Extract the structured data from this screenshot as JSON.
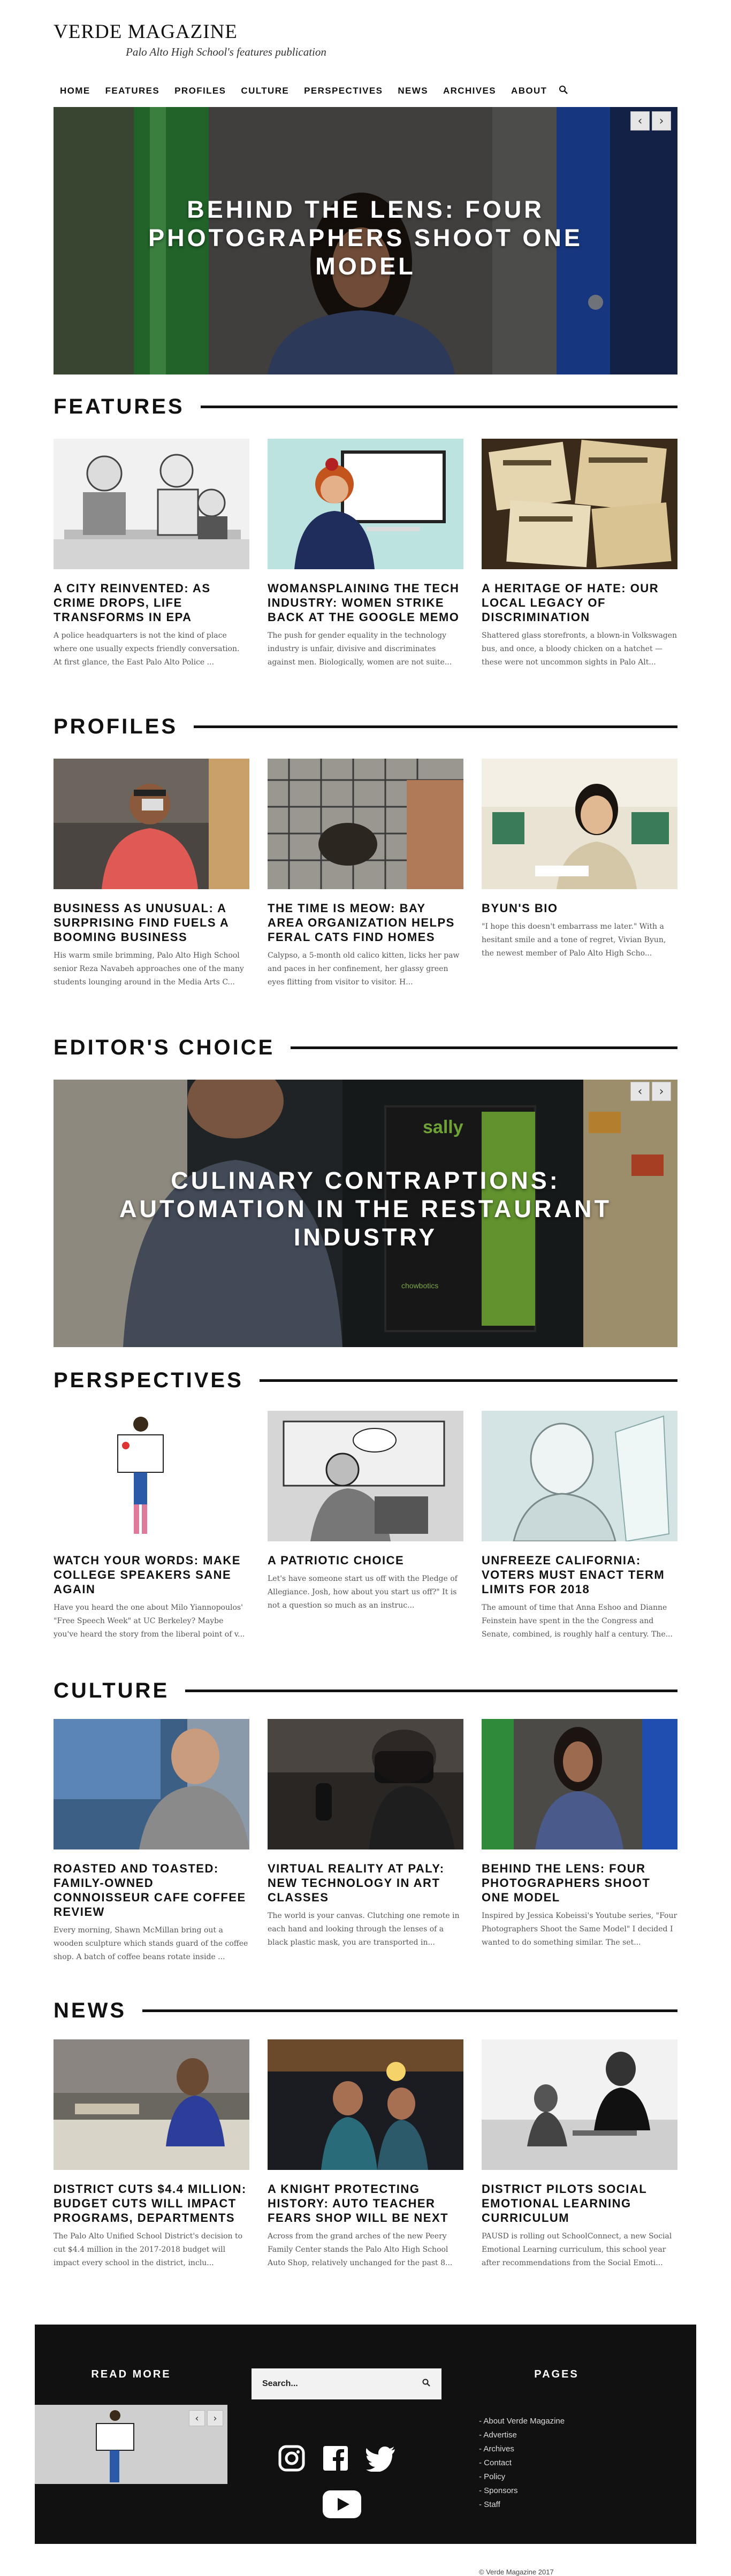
{
  "site": {
    "title": "VERDE MAGAZINE",
    "tagline": "Palo Alto High School's features publication"
  },
  "nav": {
    "items": [
      "HOME",
      "FEATURES",
      "PROFILES",
      "CULTURE",
      "PERSPECTIVES",
      "NEWS",
      "ARCHIVES",
      "ABOUT"
    ]
  },
  "hero": {
    "headline": "BEHIND THE LENS: FOUR PHOTOGRAPHERS SHOOT ONE MODEL",
    "prev": "‹",
    "next": "›"
  },
  "features": {
    "heading": "FEATURES",
    "cards": [
      {
        "title": "A CITY REINVENTED: AS CRIME DROPS, LIFE TRANSFORMS IN EPA",
        "excerpt": "A police headquarters is not the kind of place where one usually expects friendly conversation. At first glance, the East Palo Alto Police ..."
      },
      {
        "title": "WOMANSPLAINING THE TECH INDUSTRY: WOMEN STRIKE BACK AT THE GOOGLE MEMO",
        "excerpt": "The push for gender equality in the technology industry is unfair, divisive and discriminates against men. Biologically, women are not suite..."
      },
      {
        "title": "A HERITAGE OF HATE: OUR LOCAL LEGACY OF DISCRIMINATION",
        "excerpt": "Shattered glass storefronts, a blown-in Volkswagen bus, and once, a bloody chicken on a hatchet — these were not uncommon sights in Palo Alt..."
      }
    ]
  },
  "profiles": {
    "heading": "PROFILES",
    "cards": [
      {
        "title": "BUSINESS AS UNUSUAL: A SURPRISING FIND FUELS A BOOMING BUSINESS",
        "excerpt": "His warm smile brimming, Palo Alto High School senior Reza Navabeh approaches one of the many students lounging around in the Media Arts C..."
      },
      {
        "title": "THE TIME IS MEOW: BAY AREA ORGANIZATION HELPS FERAL CATS FIND HOMES",
        "excerpt": "Calypso, a 5-month old calico kitten, licks her paw and paces in her confinement, her glassy green eyes flitting from visitor to visitor. H..."
      },
      {
        "title": "BYUN'S BIO",
        "excerpt": "\"I hope this doesn't embarrass me later.\" With a hesitant smile and a tone of regret, Vivian Byun, the newest member of Palo Alto High Scho..."
      }
    ]
  },
  "editors_choice": {
    "heading": "EDITOR'S CHOICE",
    "headline": "CULINARY CONTRAPTIONS: AUTOMATION IN THE RESTAURANT INDUSTRY",
    "machine_label": "sally",
    "machine_brand": "chowbotics",
    "prev": "‹",
    "next": "›"
  },
  "perspectives": {
    "heading": "PERSPECTIVES",
    "cards": [
      {
        "title": "WATCH YOUR WORDS: MAKE COLLEGE SPEAKERS SANE AGAIN",
        "excerpt": "Have you heard the one about Milo Yiannopoulos' \"Free Speech Week\" at UC Berkeley? Maybe you've heard the story from the liberal point of v..."
      },
      {
        "title": "A PATRIOTIC CHOICE",
        "excerpt": "Let's have someone start us off with the Pledge of Allegiance. Josh, how about you start us off?\" It is not a question so much as an instruc..."
      },
      {
        "title": "UNFREEZE CALIFORNIA: VOTERS MUST ENACT TERM LIMITS FOR 2018",
        "excerpt": "The amount of time that Anna Eshoo and Dianne Feinstein have spent in the the Congress and Senate, combined, is roughly half a century. The..."
      }
    ]
  },
  "culture": {
    "heading": "CULTURE",
    "cards": [
      {
        "title": "ROASTED AND TOASTED: FAMILY-OWNED CONNOISSEUR CAFE COFFEE REVIEW",
        "excerpt": "Every morning, Shawn McMillan bring out a wooden sculpture which stands guard of the coffee shop. A batch of coffee beans rotate inside ..."
      },
      {
        "title": "VIRTUAL REALITY AT PALY: NEW TECHNOLOGY IN ART CLASSES",
        "excerpt": "The world is your canvas. Clutching one remote in each hand and looking through the lenses of a black plastic mask, you are transported in..."
      },
      {
        "title": "BEHIND THE LENS: FOUR PHOTOGRAPHERS SHOOT ONE MODEL",
        "excerpt": "Inspired by Jessica Kobeissi's Youtube series, \"Four Photographers Shoot the Same Model\" I decided I wanted to do something similar. The set..."
      }
    ]
  },
  "news": {
    "heading": "NEWS",
    "cards": [
      {
        "title": "DISTRICT CUTS $4.4 MILLION: BUDGET CUTS WILL IMPACT PROGRAMS, DEPARTMENTS",
        "excerpt": "The Palo Alto Unified School District's decision to cut $4.4 million in the 2017-2018 budget will impact every school in the district, inclu..."
      },
      {
        "title": "A KNIGHT PROTECTING HISTORY: AUTO TEACHER FEARS SHOP WILL BE NEXT",
        "excerpt": "Across from the grand arches of the new Peery Family Center stands the Palo Alto High School Auto Shop, relatively unchanged for the past 8..."
      },
      {
        "title": "DISTRICT PILOTS SOCIAL EMOTIONAL LEARNING CURRICULUM",
        "excerpt": "PAUSD is rolling out SchoolConnect, a new Social Emotional Learning curriculum, this school year after recommendations from the Social Emoti..."
      }
    ]
  },
  "footer": {
    "read_more": "READ MORE",
    "search_placeholder": "Search...",
    "pages_heading": "PAGES",
    "pages": [
      "About Verde Magazine",
      "Advertise",
      "Archives",
      "Contact",
      "Policy",
      "Sponsors",
      "Staff"
    ],
    "copyright": "© Verde Magazine 2017",
    "social_icons": [
      "instagram-icon",
      "facebook-icon",
      "twitter-icon",
      "youtube-icon"
    ],
    "prev": "‹",
    "next": "›"
  },
  "colors": {
    "text": "#111111",
    "excerpt": "#555555",
    "footer_bg": "#111111",
    "rule": "#111111"
  }
}
